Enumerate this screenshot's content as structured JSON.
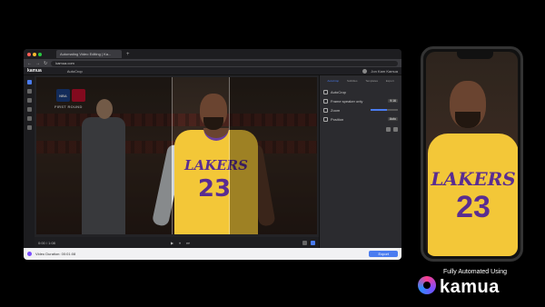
{
  "browser": {
    "tab_title": "Automating Video Editing | Ka...",
    "new_tab": "+",
    "url": "kamua.com",
    "nav_back": "←",
    "nav_forward": "→",
    "nav_reload": "↻"
  },
  "app": {
    "logo": "kamua",
    "project_label": "AutoCrop",
    "user_name": "Jon Kam Kamua"
  },
  "video": {
    "nba_badge_1": "NBA",
    "nba_badge_2": "",
    "round_label": "FIRST ROUND",
    "jersey_team": "LAKERS",
    "jersey_number": "23"
  },
  "timeline": {
    "time_readout": "0:00 / 1:08",
    "play_symbol": "▶",
    "pause_symbol": "⏸",
    "next_symbol": "⏭"
  },
  "panel": {
    "tabs": [
      "AutoCrop",
      "Subtitles",
      "Templates",
      "Export"
    ],
    "rows": [
      {
        "label": "AutoCrop",
        "value": ""
      },
      {
        "label": "Frame speaker only",
        "value": "9:16"
      },
      {
        "label": "Zoom",
        "value": ""
      },
      {
        "label": "Position",
        "value": "Auto"
      }
    ],
    "zoom_level": 0.6
  },
  "status": {
    "left_text": "Video Duration: 00:01:08",
    "export_label": "Export"
  },
  "phone": {
    "jersey_team": "LAKERS",
    "jersey_number": "23"
  },
  "brand": {
    "tagline": "Fully Automated Using",
    "name": "kamua"
  },
  "colors": {
    "accent": "#4a7cf0",
    "jersey_gold": "#f3c738",
    "jersey_purple": "#5a2d91"
  }
}
